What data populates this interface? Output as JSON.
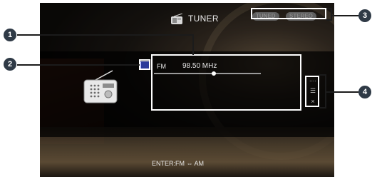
{
  "header": {
    "title": "TUNER",
    "badges": [
      "TUNED",
      "STEREO"
    ]
  },
  "tuner": {
    "band": "FM",
    "frequency": "98.50 MHz",
    "tuning_position": 0.56
  },
  "side_buttons": [
    "....",
    "☰",
    "×"
  ],
  "footer": {
    "hint": "ENTER:FM ⇔ AM"
  },
  "callouts": [
    "1",
    "2",
    "3",
    "4"
  ],
  "colors": {
    "callout_fill": "#2f3a46",
    "badge_fill": "#5f5f5f",
    "band_icon": "#2b3a9a"
  }
}
